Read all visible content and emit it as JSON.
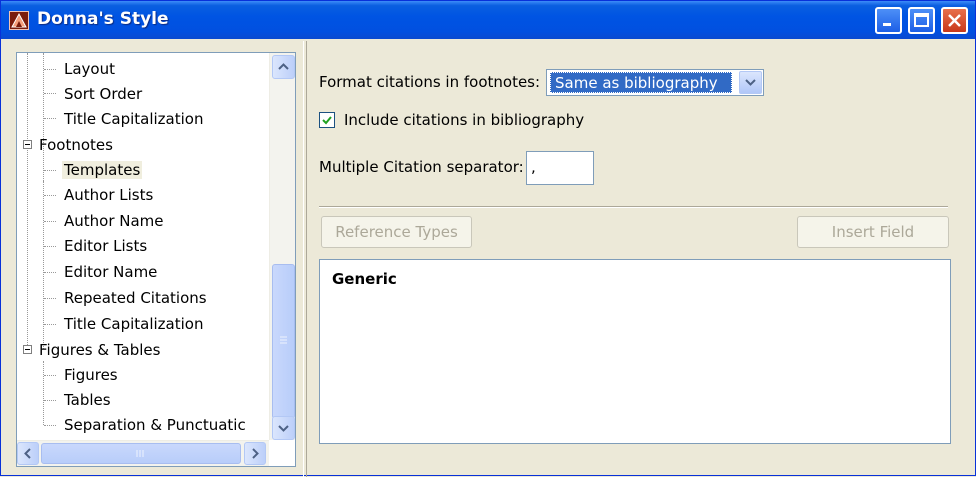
{
  "window": {
    "title": "Donna's Style",
    "controls": {
      "minimize": "minimize-icon",
      "maximize": "maximize-icon",
      "close": "close-icon"
    }
  },
  "tree": {
    "items": [
      {
        "label": "Layout",
        "level": 1
      },
      {
        "label": "Sort Order",
        "level": 1
      },
      {
        "label": "Title Capitalization",
        "level": 1
      },
      {
        "label": "Footnotes",
        "level": 0,
        "expanded": true
      },
      {
        "label": "Templates",
        "level": 1,
        "selected": true
      },
      {
        "label": "Author Lists",
        "level": 1
      },
      {
        "label": "Author Name",
        "level": 1
      },
      {
        "label": "Editor Lists",
        "level": 1
      },
      {
        "label": "Editor Name",
        "level": 1
      },
      {
        "label": "Repeated Citations",
        "level": 1
      },
      {
        "label": "Title Capitalization",
        "level": 1
      },
      {
        "label": "Figures & Tables",
        "level": 0,
        "expanded": true
      },
      {
        "label": "Figures",
        "level": 1
      },
      {
        "label": "Tables",
        "level": 1
      },
      {
        "label": "Separation & Punctuatic",
        "level": 1
      }
    ]
  },
  "form": {
    "format_label": "Format citations in footnotes:",
    "format_value": "Same as bibliography",
    "include_label": "Include citations in bibliography",
    "include_checked": true,
    "separator_label": "Multiple Citation separator:",
    "separator_value": ","
  },
  "toolbar": {
    "reference_types": "Reference Types",
    "insert_field": "Insert Field"
  },
  "editor": {
    "content": "Generic"
  },
  "colors": {
    "titlebar": "#0054e3",
    "face": "#ece9d8",
    "selection": "#316ac5"
  }
}
